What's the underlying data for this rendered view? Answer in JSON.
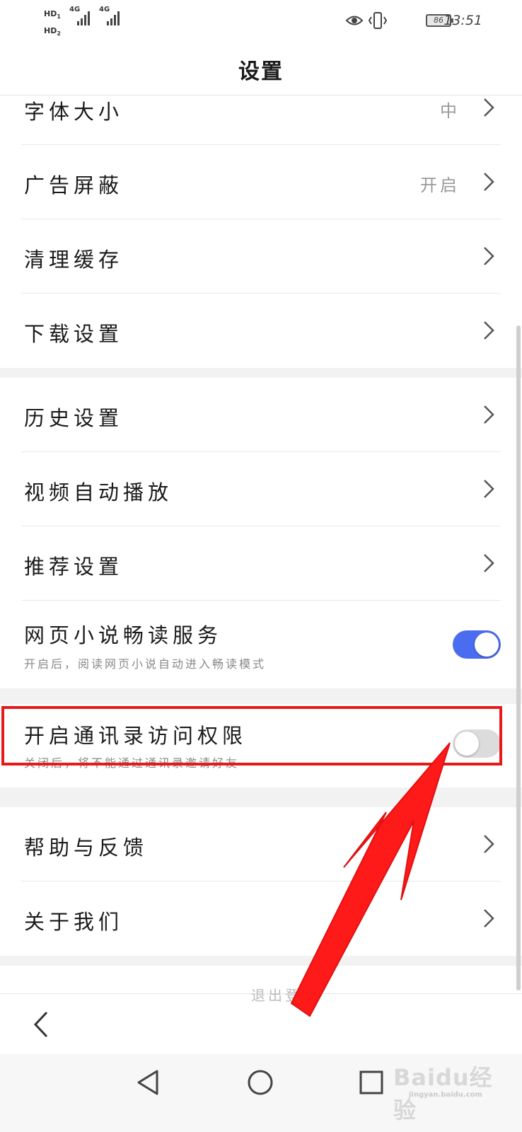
{
  "status_bar": {
    "sim1": "HD",
    "sim1_slot": "1",
    "sim2": "HD",
    "sim2_slot": "2",
    "net1": "4G",
    "net2": "4G",
    "battery": "86",
    "time": "13:51"
  },
  "header": {
    "title": "设置"
  },
  "settings": {
    "font_size": {
      "label": "字体大小",
      "value": "中"
    },
    "ad_block": {
      "label": "广告屏蔽",
      "value": "开启"
    },
    "clear_cache": {
      "label": "清理缓存"
    },
    "download": {
      "label": "下载设置"
    },
    "history": {
      "label": "历史设置"
    },
    "video_autoplay": {
      "label": "视频自动播放"
    },
    "recommend": {
      "label": "推荐设置"
    },
    "novel_reader": {
      "label": "网页小说畅读服务",
      "desc": "开启后，阅读网页小说自动进入畅读模式",
      "enabled": true
    },
    "contacts_permission": {
      "label": "开启通讯录访问权限",
      "desc": "关闭后，将不能通过通讯录邀请好友",
      "enabled": false
    },
    "help": {
      "label": "帮助与反馈"
    },
    "about": {
      "label": "关于我们"
    }
  },
  "toolbar": {
    "partial_text": "退出登录"
  },
  "watermark": {
    "text": "Baidu经验",
    "sub": "jingyan.baidu.com"
  },
  "colors": {
    "accent": "#4a6cf0",
    "highlight": "#e8191a",
    "arrow": "#ff0000"
  },
  "icons": [
    "eye-icon",
    "vibrate-icon",
    "battery-icon",
    "chevron-right-icon",
    "back-arrow-icon",
    "nav-back-icon",
    "nav-home-icon",
    "nav-recents-icon"
  ]
}
